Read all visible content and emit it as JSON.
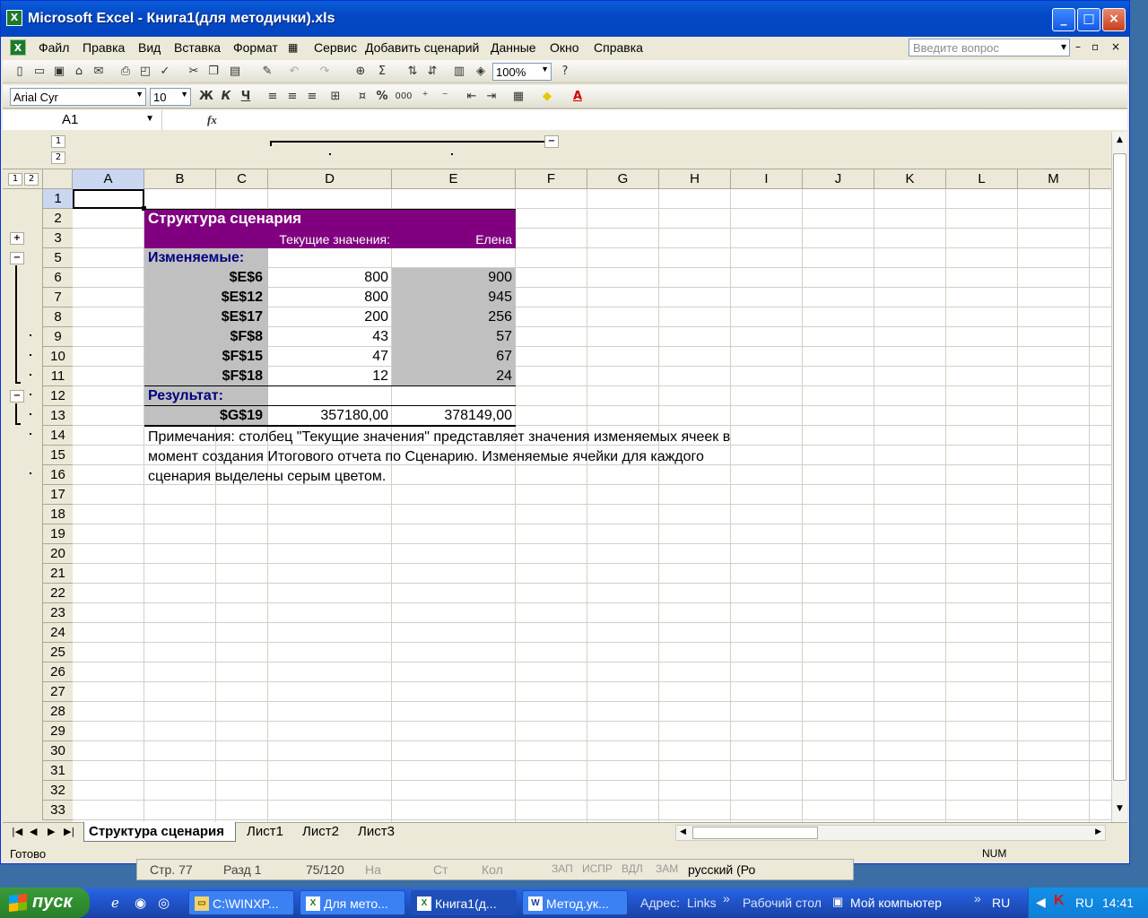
{
  "window": {
    "title": "Microsoft Excel - Книга1(для методички).xls",
    "app_icon": "excel-icon",
    "controls": {
      "minimize": "_",
      "maximize": "□",
      "close": "×"
    }
  },
  "menu": {
    "items": [
      "Файл",
      "Правка",
      "Вид",
      "Вставка",
      "Формат",
      "Сервис",
      "Добавить сценарий",
      "Данные",
      "Окно",
      "Справка"
    ],
    "ask_placeholder": "Введите вопрос",
    "doc_controls": {
      "minimize": "–",
      "restore": "▫",
      "close": "×"
    }
  },
  "toolbar_standard": {
    "zoom": "100%",
    "icons": [
      "new-icon",
      "open-icon",
      "save-icon",
      "permission-icon",
      "email-icon",
      "print-icon",
      "print-preview-icon",
      "spelling-icon",
      "cut-icon",
      "copy-icon",
      "paste-icon",
      "format-painter-icon",
      "undo-icon",
      "redo-icon",
      "hyperlink-icon",
      "autosum-icon",
      "sort-asc-icon",
      "sort-desc-icon",
      "chart-wizard-icon",
      "drawing-icon",
      "help-icon"
    ]
  },
  "toolbar_formatting": {
    "font": "Arial Cyr",
    "size": "10",
    "bold": "Ж",
    "italic": "К",
    "underline": "Ч",
    "percent": "%",
    "thousands": "000"
  },
  "formula_bar": {
    "name_box": "A1",
    "fx": "fx",
    "value": ""
  },
  "outline": {
    "col_levels": [
      "1",
      "2"
    ],
    "row_levels": [
      "1",
      "2"
    ],
    "row_buttons": [
      {
        "row": "3",
        "symbol": "+"
      },
      {
        "row": "5",
        "symbol": "−"
      },
      {
        "row": "12",
        "symbol": "−"
      }
    ],
    "col_button": "−"
  },
  "columns": [
    "A",
    "B",
    "C",
    "D",
    "E",
    "F",
    "G",
    "H",
    "I",
    "J",
    "K",
    "L",
    "M"
  ],
  "rows": [
    "1",
    "2",
    "3",
    "5",
    "6",
    "7",
    "8",
    "9",
    "10",
    "11",
    "12",
    "13",
    "14",
    "15",
    "16",
    "17",
    "18",
    "19",
    "20",
    "21",
    "22",
    "23",
    "24",
    "25",
    "26",
    "27",
    "28",
    "29",
    "30",
    "31",
    "32",
    "33"
  ],
  "report": {
    "title": "Структура сценария",
    "col_current": "Текущие значения:",
    "col_scenario": "Елена",
    "changing_label": "Изменяемые:",
    "changing": [
      {
        "cell": "$E$6",
        "current": "800",
        "scenario": "900"
      },
      {
        "cell": "$E$12",
        "current": "800",
        "scenario": "945"
      },
      {
        "cell": "$E$17",
        "current": "200",
        "scenario": "256"
      },
      {
        "cell": "$F$8",
        "current": "43",
        "scenario": "57"
      },
      {
        "cell": "$F$15",
        "current": "47",
        "scenario": "67"
      },
      {
        "cell": "$F$18",
        "current": "12",
        "scenario": "24"
      }
    ],
    "result_label": "Результат:",
    "result": {
      "cell": "$G$19",
      "current": "357180,00",
      "scenario": "378149,00"
    },
    "notes": [
      "Примечания: столбец \"Текущие значения\" представляет значения изменяемых ячеек в",
      "момент создания Итогового отчета по Сценарию. Изменяемые ячейки для каждого",
      "сценария выделены серым цветом."
    ]
  },
  "sheet_tabs": [
    "Структура сценария",
    "Лист1",
    "Лист2",
    "Лист3"
  ],
  "active_tab": "Структура сценария",
  "status": {
    "left": "Готово",
    "num": "NUM"
  },
  "background_window": [
    "Стр. 77",
    "Разд 1",
    "75/120",
    "На",
    "Ст",
    "Кол",
    "ЗАП",
    "ИСПР",
    "ВДЛ",
    "ЗАМ",
    "русский (Ро"
  ],
  "taskbar": {
    "start": "пуск",
    "tasks": [
      "C:\\WINXP...",
      "Для мето...",
      "Книга1(д...",
      "Метод.ук..."
    ],
    "address_label": "Адрес:",
    "links": "Links",
    "desktop": "Рабочий стол",
    "mycomputer": "Мой компьютер",
    "lang": "RU",
    "tray_lang": "RU",
    "clock": "14:41"
  },
  "colors": {
    "header_purple": "#800080",
    "changing_gray": "#c0c0c0",
    "label_navy": "#000080"
  }
}
